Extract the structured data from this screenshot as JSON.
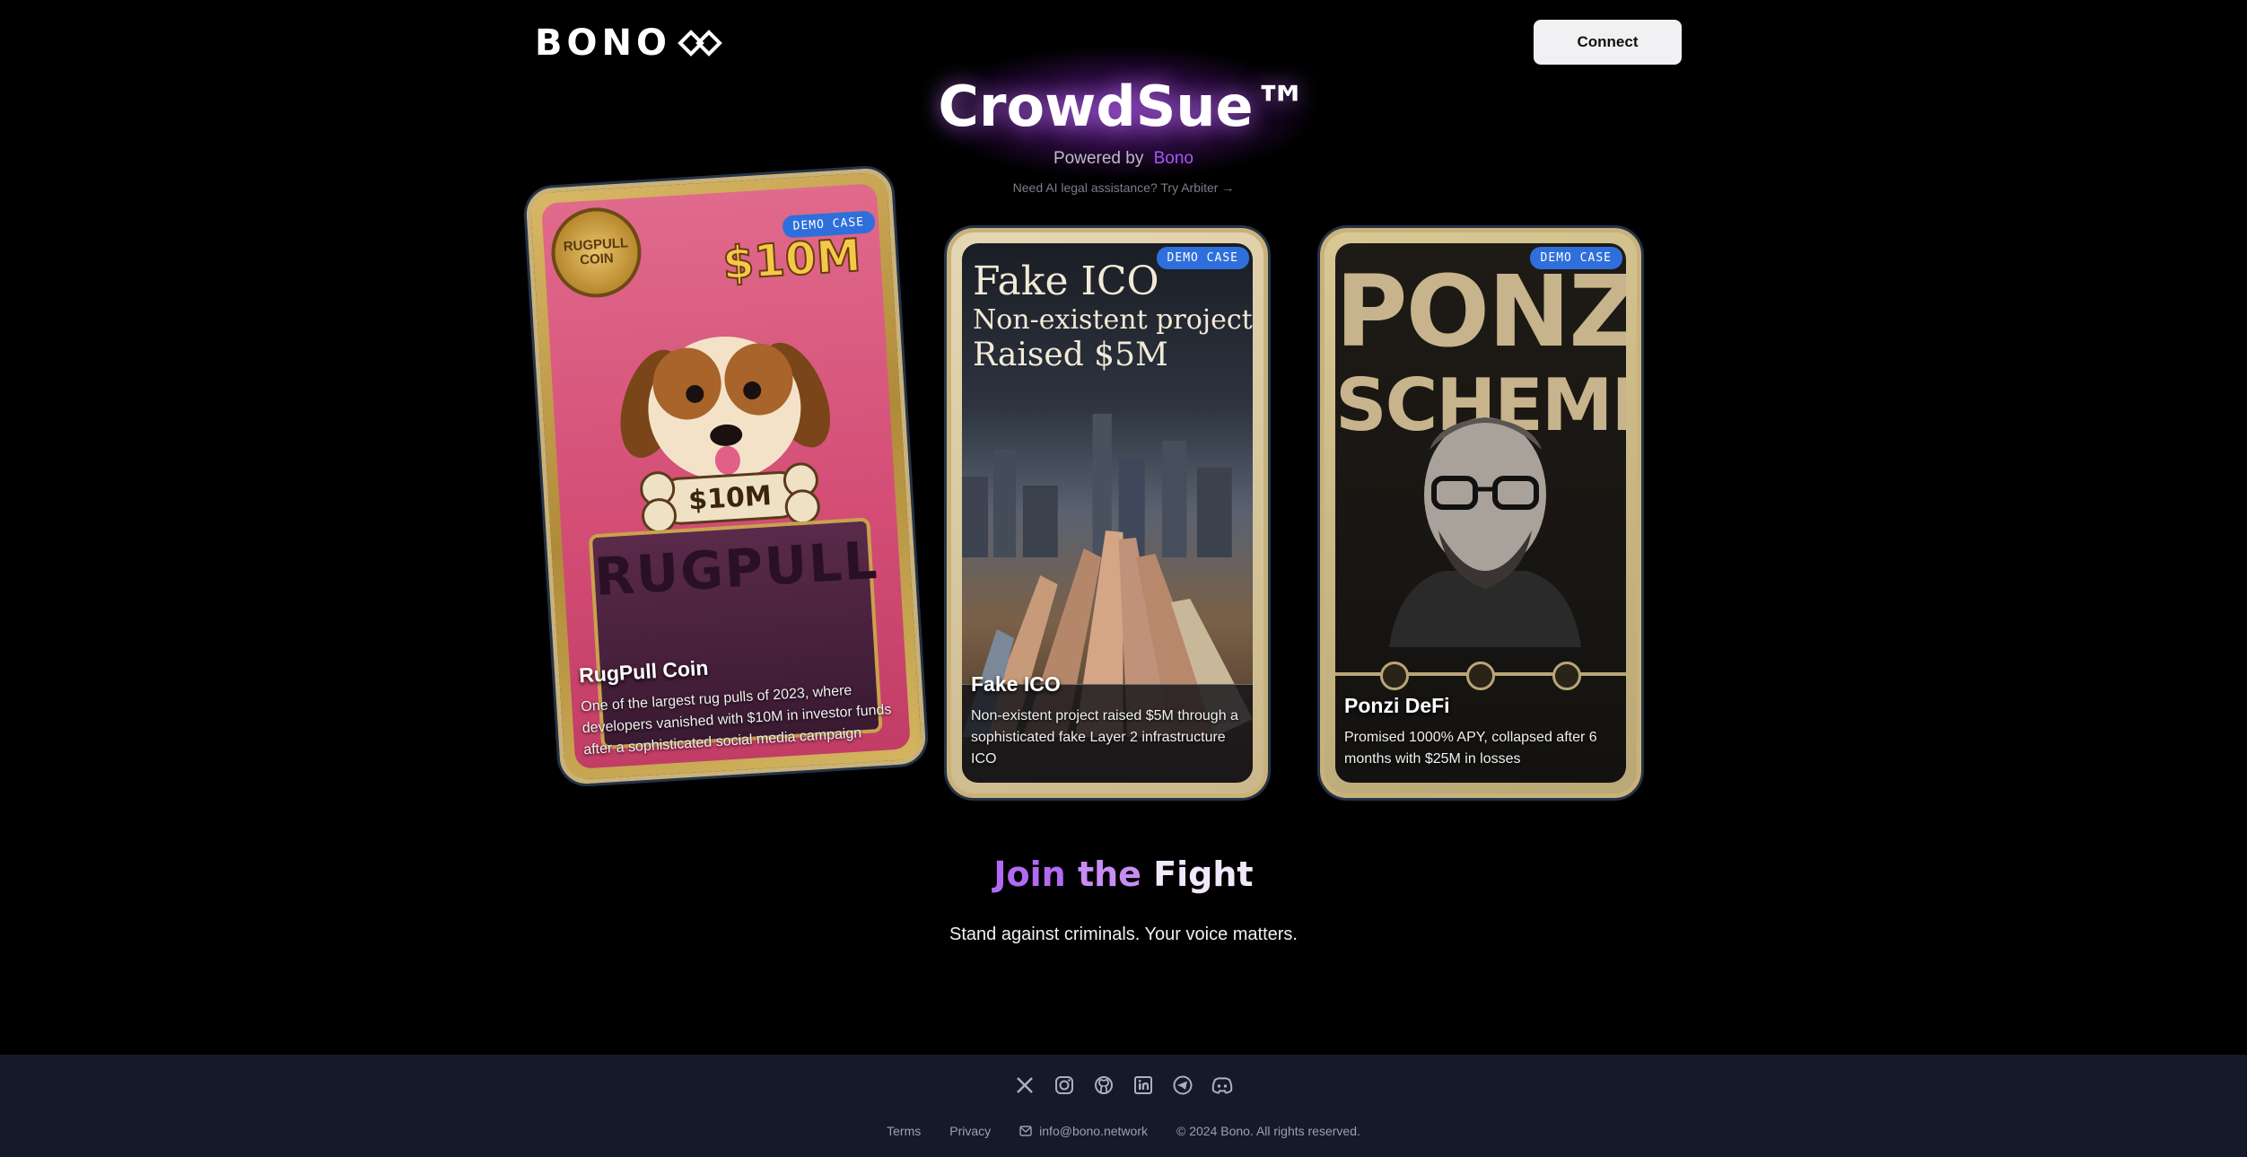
{
  "header": {
    "logo_text": "BONO",
    "connect_label": "Connect"
  },
  "hero": {
    "title": "CrowdSue™",
    "powered_prefix": "Powered by",
    "powered_brand": "Bono",
    "arbiter_text": "Need AI legal assistance? Try Arbiter →"
  },
  "cards": [
    {
      "badge": "DEMO CASE",
      "title": "RugPull Coin",
      "description": "One of the largest rug pulls of 2023, where developers vanished with $10M in investor funds after a sophisticated social media campaign",
      "art": {
        "amount": "$10M",
        "bone_text": "$10M",
        "coin_text": "RUGPULL COIN",
        "banner_text": "RUGPULL"
      }
    },
    {
      "badge": "DEMO CASE",
      "title": "Fake ICO",
      "description": "Non-existent project raised $5M through a sophisticated fake Layer 2 infrastructure ICO",
      "art": {
        "line1": "Fake ICO",
        "line2": "Non-existent project",
        "line3": "Raised $5M"
      }
    },
    {
      "badge": "DEMO CASE",
      "title": "Ponzi DeFi",
      "description": "Promised 1000% APY, collapsed after 6 months with $25M in losses",
      "art": {
        "line1": "PONZI",
        "line2": "SCHEME"
      }
    }
  ],
  "join": {
    "word1": "Join",
    "word2": "the",
    "word3": "Fight",
    "subtitle": "Stand against criminals. Your voice matters."
  },
  "footer": {
    "socials": [
      "x-icon",
      "instagram-icon",
      "github-icon",
      "linkedin-icon",
      "telegram-icon",
      "discord-icon"
    ],
    "terms": "Terms",
    "privacy": "Privacy",
    "email": "info@bono.network",
    "copyright": "© 2024 Bono. All rights reserved."
  },
  "colors": {
    "accent_purple": "#a855f7",
    "badge_blue": "#2f6fdc",
    "footer_bg": "#141a28"
  }
}
